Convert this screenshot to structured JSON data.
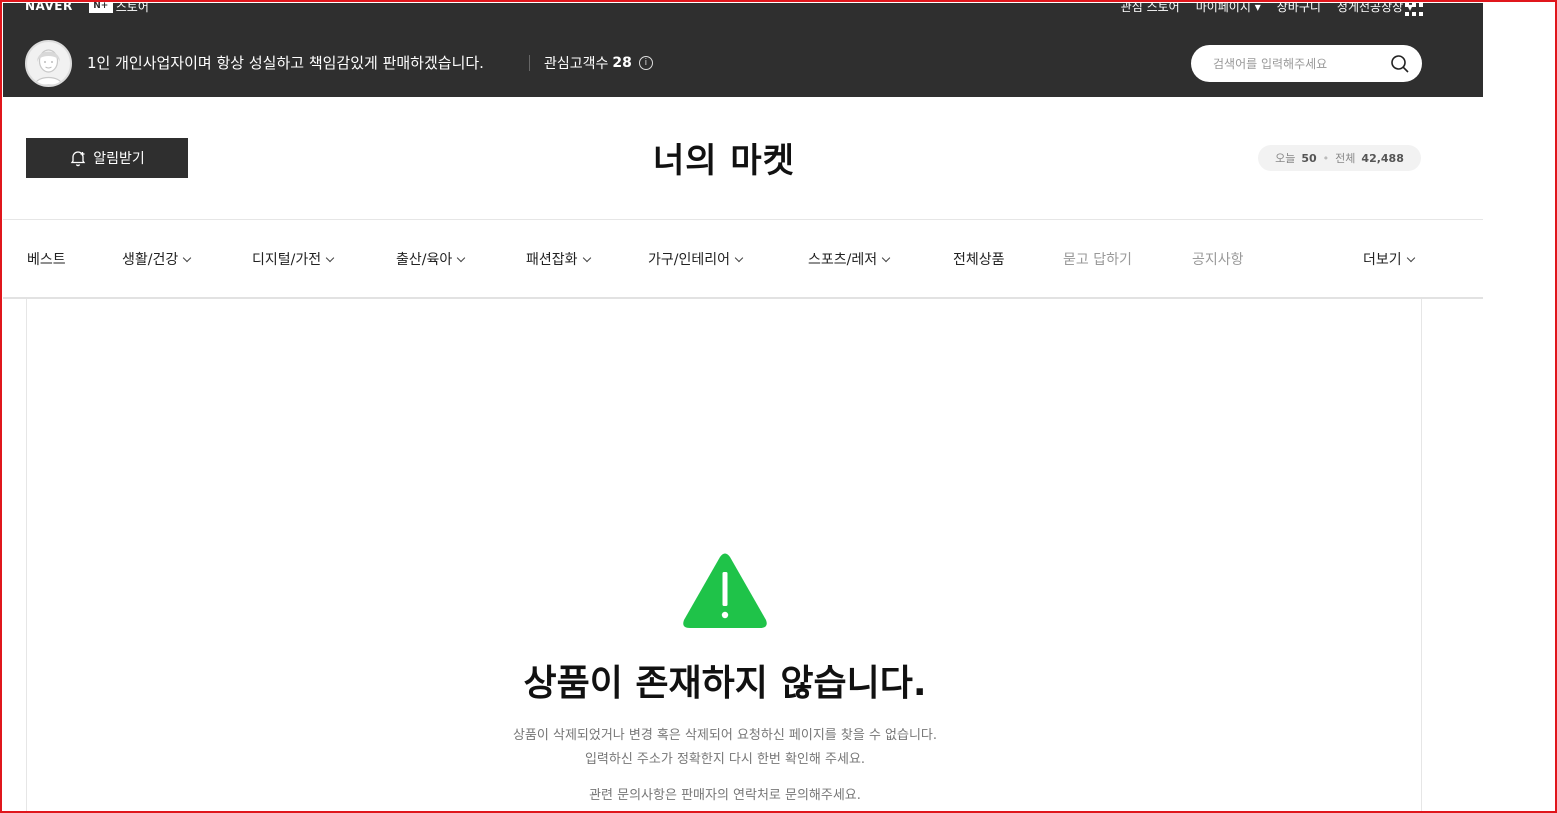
{
  "gnb": {
    "naver": "NAVER",
    "store_badge": "N+",
    "store": "스토어",
    "links": [
      "관심 스토어",
      "마이페이지",
      "장바구니",
      "정게전공장장"
    ]
  },
  "seller": {
    "description": "1인 개인사업자이며 항상 성실하고 책임감있게 판매하겠습니다.",
    "fans_label": "관심고객수",
    "fans_count": "28",
    "info_glyph": "i"
  },
  "search": {
    "placeholder": "검색어를 입력해주세요"
  },
  "store": {
    "alarm_label": "알림받기",
    "title": "너의 마켓",
    "visit_today_label": "오늘",
    "visit_today": "50",
    "visit_sep": "•",
    "visit_total_label": "전체",
    "visit_total": "42,488"
  },
  "categories": [
    {
      "label": "베스트"
    },
    {
      "label": "생활/건강"
    },
    {
      "label": "디지털/가전"
    },
    {
      "label": "출산/육아"
    },
    {
      "label": "패션잡화"
    },
    {
      "label": "가구/인테리어"
    },
    {
      "label": "스포츠/레저"
    },
    {
      "label": "전체상품"
    },
    {
      "label": "묻고 답하기"
    },
    {
      "label": "공지사항"
    },
    {
      "label": "더보기"
    }
  ],
  "error": {
    "title": "상품이 존재하지 않습니다.",
    "line1": "상품이 삭제되었거나 변경 혹은 삭제되어 요청하신 페이지를 찾을 수 없습니다.",
    "line2": "입력하신 주소가 정확한지 다시 한번 확인해 주세요.",
    "line3": "관련 문의사항은 판매자의 연락처로 문의해주세요."
  },
  "colors": {
    "header_bg": "#2f2f2f",
    "warning": "#1fc349",
    "frame": "#e0161c"
  }
}
